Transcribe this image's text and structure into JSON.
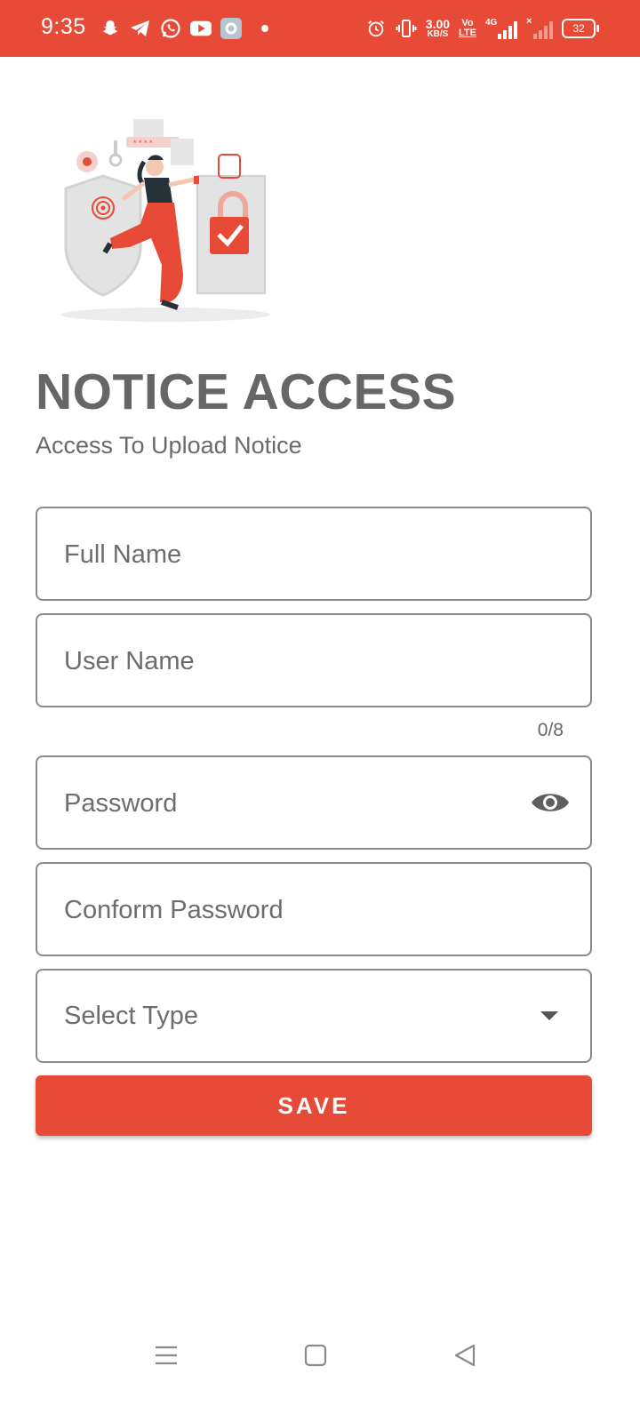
{
  "status_bar": {
    "time": "9:35",
    "net_speed_value": "3.00",
    "net_speed_unit": "KB/S",
    "volte_top": "Vo",
    "volte_bottom": "LTE",
    "network": "4G",
    "battery": "32",
    "icons_left": [
      "snapchat-icon",
      "telegram-icon",
      "whatsapp-icon",
      "youtube-icon",
      "settings-app-icon"
    ],
    "icons_right": [
      "alarm-icon",
      "vibrate-icon",
      "signal-icon",
      "signal-no-service-icon",
      "battery-icon"
    ]
  },
  "header": {
    "title": "NOTICE ACCESS",
    "subtitle": "Access To Upload Notice"
  },
  "form": {
    "full_name_placeholder": "Full Name",
    "user_name_placeholder": "User Name",
    "user_name_counter": "0/8",
    "password_placeholder": "Password",
    "confirm_password_placeholder": "Conform Password",
    "select_type_label": "Select Type",
    "save_label": "SAVE"
  },
  "colors": {
    "accent": "#e74b37",
    "text": "#5f5f5f",
    "border": "#8a8a8a"
  }
}
